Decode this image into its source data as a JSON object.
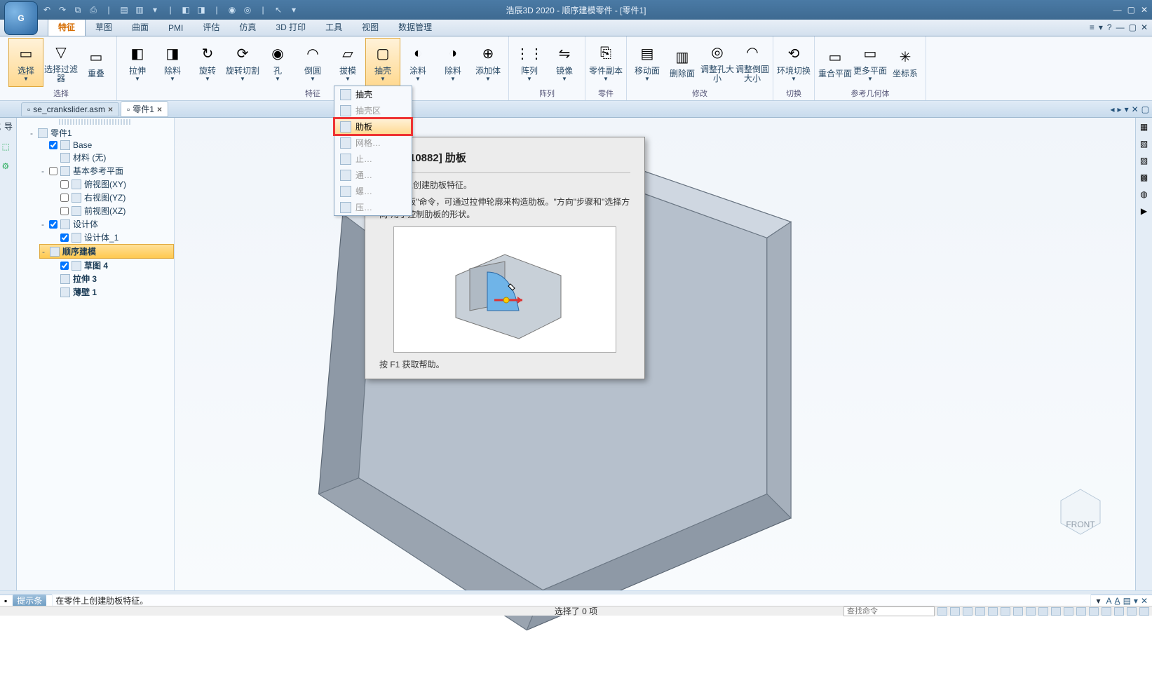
{
  "app": {
    "title": "浩辰3D 2020 - 顺序建模零件 - [零件1]",
    "logo_letter": "G"
  },
  "ribbon_tabs": [
    "特征",
    "草图",
    "曲面",
    "PMI",
    "评估",
    "仿真",
    "3D 打印",
    "工具",
    "视图",
    "数据管理"
  ],
  "ribbon_active_tab": "特征",
  "ribbon": {
    "groups": [
      {
        "caption": "选择",
        "buttons": [
          {
            "label": "选择",
            "icon": "▭",
            "active": true,
            "dd": true
          },
          {
            "label": "选择过滤器",
            "icon": "▽"
          },
          {
            "label": "重叠",
            "icon": "▭"
          }
        ]
      },
      {
        "caption": "特征",
        "buttons": [
          {
            "label": "拉伸",
            "icon": "◧",
            "dd": true
          },
          {
            "label": "除料",
            "icon": "◨",
            "dd": true
          },
          {
            "label": "旋转",
            "icon": "↻",
            "dd": true
          },
          {
            "label": "旋转切割",
            "icon": "⟳",
            "dd": true
          },
          {
            "label": "孔",
            "icon": "◉",
            "dd": true
          },
          {
            "label": "倒圆",
            "icon": "◠",
            "dd": true
          },
          {
            "label": "拔模",
            "icon": "▱",
            "dd": true
          },
          {
            "label": "抽壳",
            "icon": "▢",
            "dd": true,
            "active": true
          },
          {
            "label": "涂料",
            "icon": "◐",
            "dd": true
          },
          {
            "label": "除料",
            "icon": "◑",
            "dd": true
          },
          {
            "label": "添加体",
            "icon": "⊕",
            "dd": true
          }
        ]
      },
      {
        "caption": "阵列",
        "buttons": [
          {
            "label": "阵列",
            "icon": "⋮⋮",
            "dd": true
          },
          {
            "label": "镜像",
            "icon": "⇋",
            "dd": true
          }
        ]
      },
      {
        "caption": "零件",
        "buttons": [
          {
            "label": "零件副本",
            "icon": "⎘",
            "dd": true
          }
        ]
      },
      {
        "caption": "修改",
        "buttons": [
          {
            "label": "移动面",
            "icon": "▤",
            "dd": true
          },
          {
            "label": "删除面",
            "icon": "▥"
          },
          {
            "label": "调整孔大小",
            "icon": "◎"
          },
          {
            "label": "调整倒圆大小",
            "icon": "◠"
          }
        ]
      },
      {
        "caption": "切换",
        "buttons": [
          {
            "label": "环境切换",
            "icon": "⟲",
            "dd": true
          }
        ]
      },
      {
        "caption": "参考几何体",
        "buttons": [
          {
            "label": "重合平面",
            "icon": "▭"
          },
          {
            "label": "更多平面",
            "icon": "▭",
            "dd": true
          },
          {
            "label": "坐标系",
            "icon": "✳"
          }
        ]
      }
    ]
  },
  "doc_tabs": [
    {
      "label": "se_crankslider.asm",
      "active": false
    },
    {
      "label": "零件1",
      "active": true
    }
  ],
  "dropdown": {
    "items": [
      {
        "label": "抽壳"
      },
      {
        "label": "抽壳区",
        "cut": true
      },
      {
        "label": "肋板",
        "highlight": true
      },
      {
        "label": "网格…",
        "cut": true
      },
      {
        "label": "止…",
        "cut": true
      },
      {
        "label": "通…",
        "cut": true
      },
      {
        "label": "螺…",
        "cut": true
      },
      {
        "label": "压…",
        "cut": true
      }
    ]
  },
  "tooltip": {
    "title": "[10882] 肋板",
    "desc1": "在零件上创建肋板特征。",
    "desc2": "使用\"肋板\"命令，可通过拉伸轮廓来构造肋板。\"方向\"步骤和\"选择方向\"用于控制肋板的形状。",
    "footer": "按 F1 获取帮助。"
  },
  "tree": {
    "root": "零件1",
    "items": [
      {
        "label": "Base",
        "chk": true,
        "lvl": 1
      },
      {
        "label": "材料 (无)",
        "lvl": 2
      },
      {
        "label": "基本参考平面",
        "chk": false,
        "exp": "-",
        "lvl": 1
      },
      {
        "label": "俯视图(XY)",
        "chk": false,
        "lvl": 2
      },
      {
        "label": "右视图(YZ)",
        "chk": false,
        "lvl": 2
      },
      {
        "label": "前视图(XZ)",
        "chk": false,
        "lvl": 2
      },
      {
        "label": "设计体",
        "chk": true,
        "exp": "-",
        "lvl": 1
      },
      {
        "label": "设计体_1",
        "chk": true,
        "lvl": 2
      },
      {
        "label": "顺序建模",
        "exp": "-",
        "lvl": 1,
        "sel": true
      },
      {
        "label": "草图 4",
        "chk": true,
        "lvl": 2,
        "bold": true
      },
      {
        "label": "拉伸 3",
        "lvl": 2,
        "bold": true
      },
      {
        "label": "薄壁 1",
        "lvl": 2,
        "bold": true
      }
    ]
  },
  "status": {
    "prompt": "提示条",
    "message": "在零件上创建肋板特征。"
  },
  "bottom": {
    "selection": "选择了 0 项",
    "search_placeholder": "查找命令"
  }
}
